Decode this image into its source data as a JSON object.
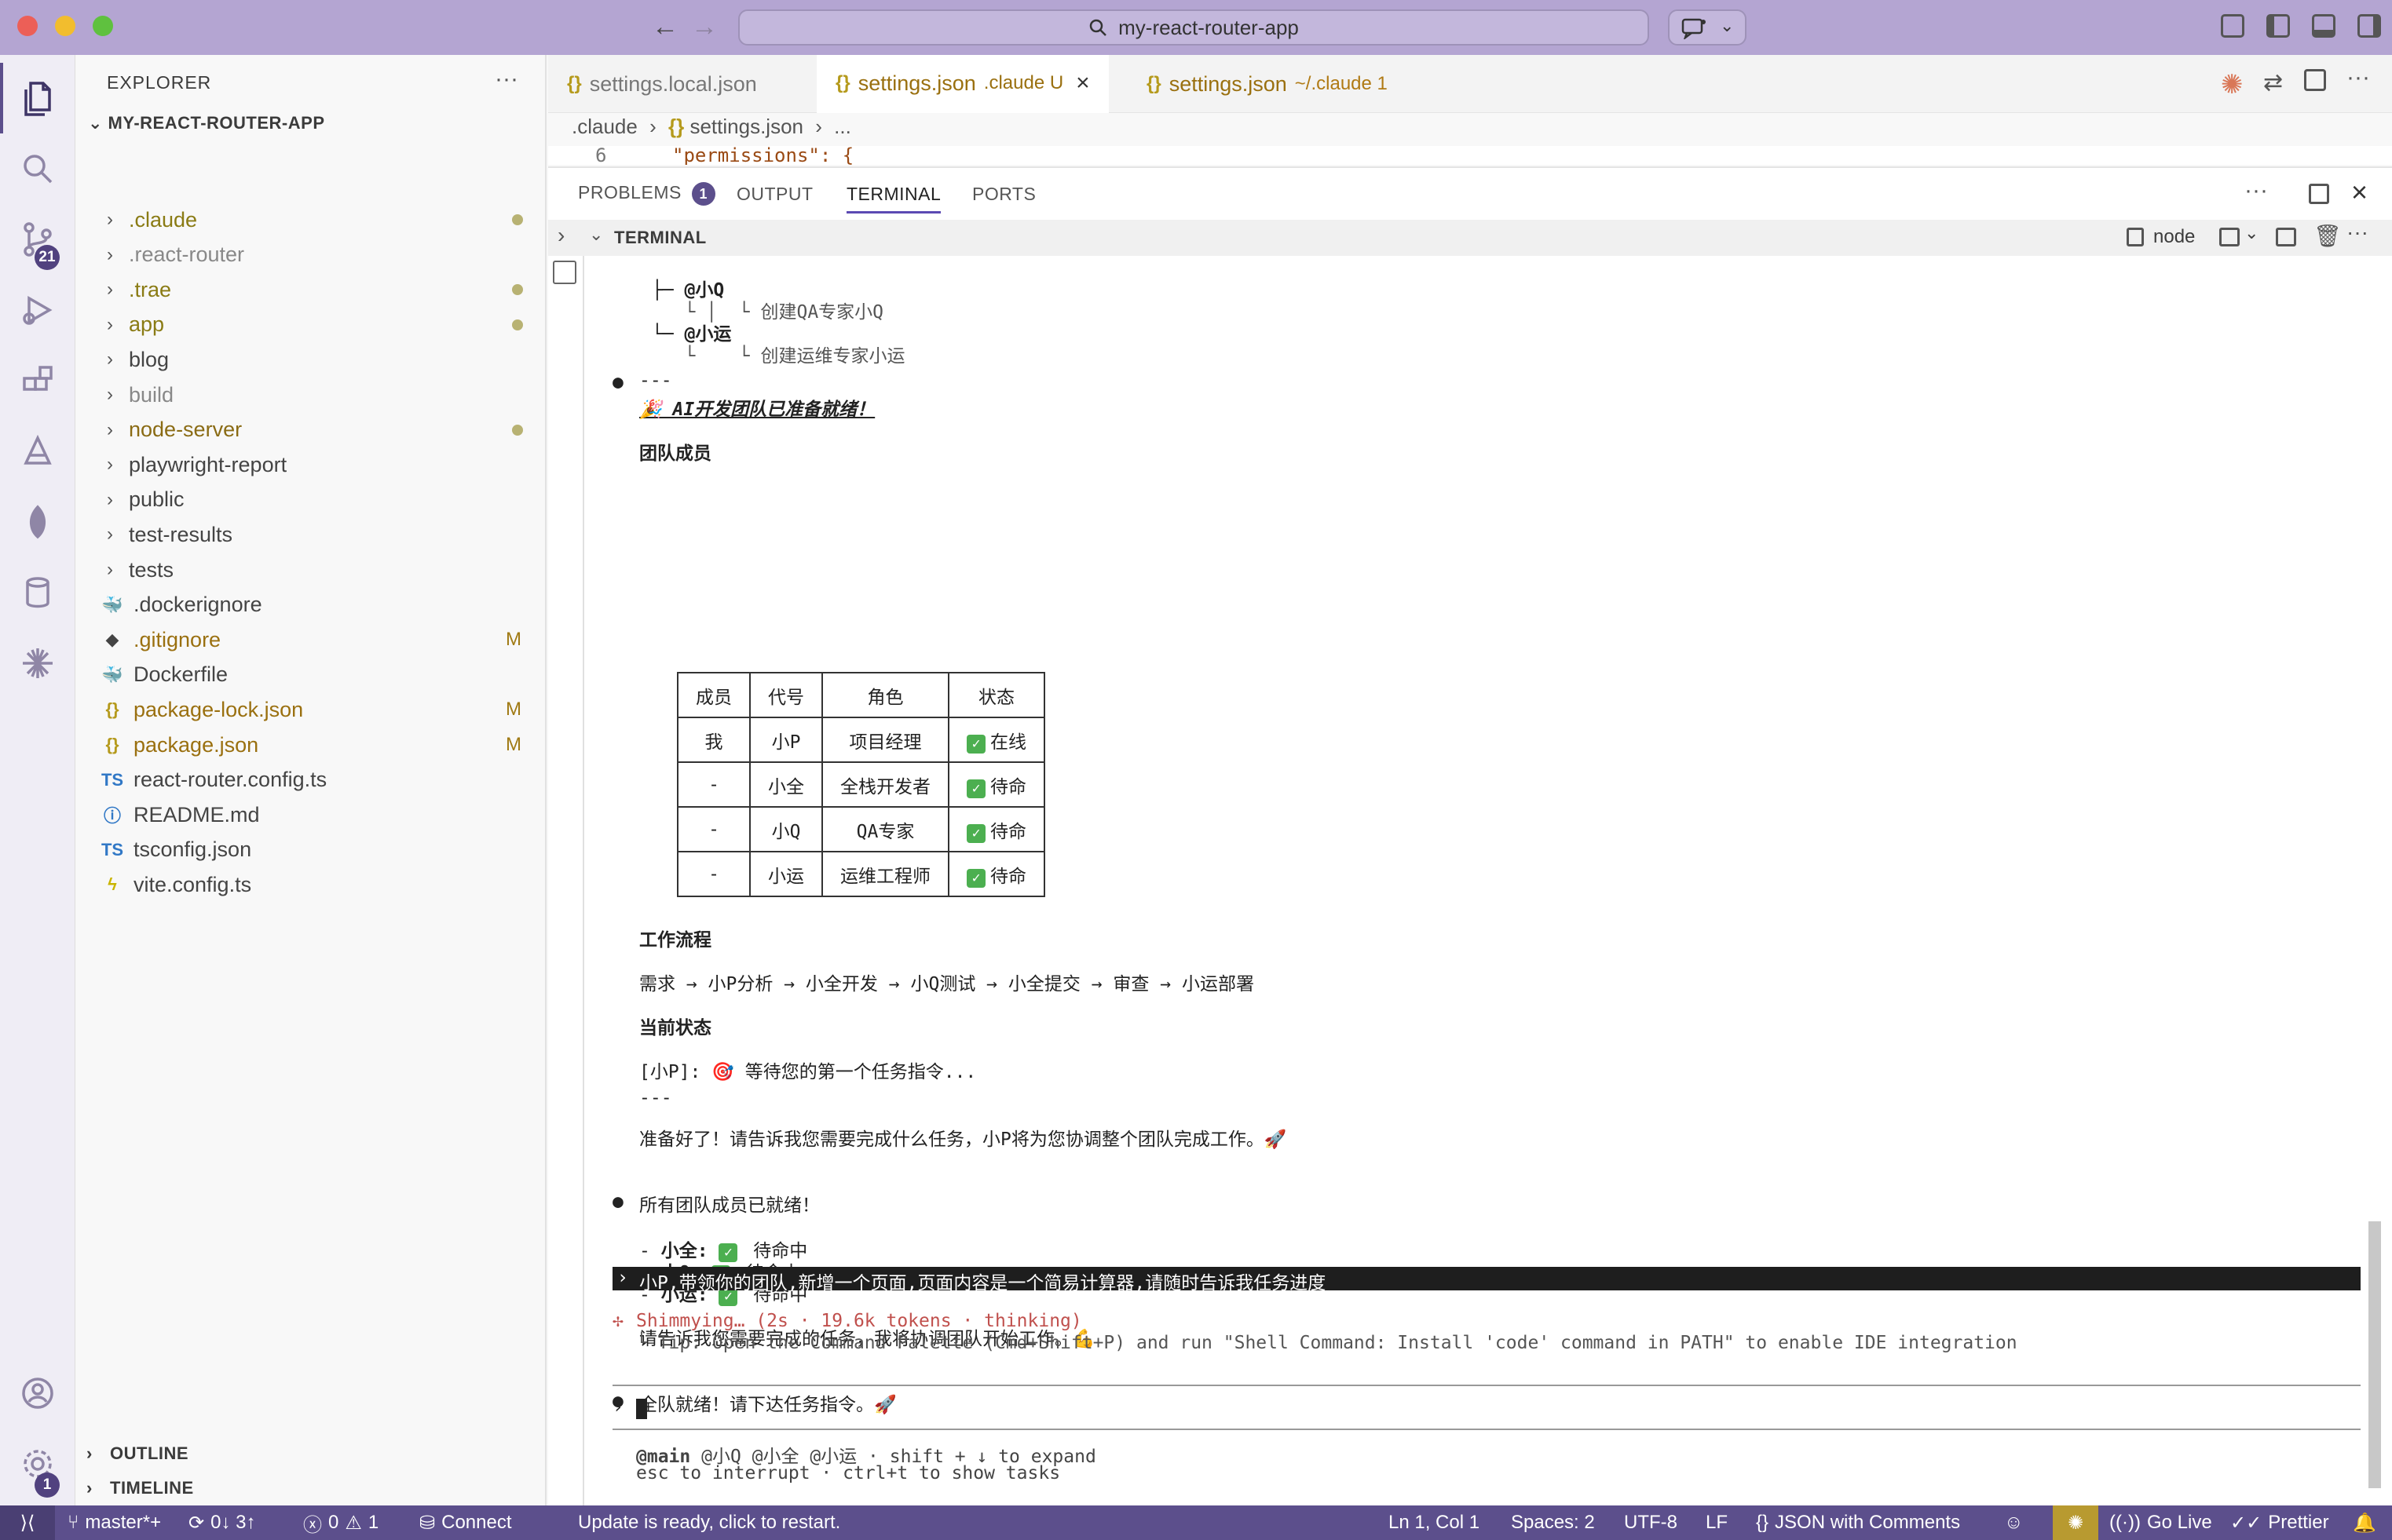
{
  "window": {
    "search": "my-react-router-app"
  },
  "activity": {
    "scm_badge": "21",
    "settings_badge": "1"
  },
  "explorer": {
    "title": "EXPLORER",
    "root": "MY-REACT-ROUTER-APP",
    "items": [
      {
        "name": ".claude",
        "folder": true,
        "color": "#8a7b14",
        "marker": "dot"
      },
      {
        "name": ".react-router",
        "folder": true,
        "color": "#888888",
        "marker": ""
      },
      {
        "name": ".trae",
        "folder": true,
        "color": "#8a7b14",
        "marker": "dot"
      },
      {
        "name": "app",
        "folder": true,
        "color": "#8a7b14",
        "marker": "dot"
      },
      {
        "name": "blog",
        "folder": true,
        "color": "#444444",
        "marker": ""
      },
      {
        "name": "build",
        "folder": true,
        "color": "#888888",
        "marker": ""
      },
      {
        "name": "node-server",
        "folder": true,
        "color": "#8a6b14",
        "marker": "dot"
      },
      {
        "name": "playwright-report",
        "folder": true,
        "color": "#444444",
        "marker": ""
      },
      {
        "name": "public",
        "folder": true,
        "color": "#444444",
        "marker": ""
      },
      {
        "name": "test-results",
        "folder": true,
        "color": "#444444",
        "marker": ""
      },
      {
        "name": "tests",
        "folder": true,
        "color": "#444444",
        "marker": ""
      },
      {
        "name": ".dockerignore",
        "folder": false,
        "icon": "🐳",
        "iconColor": "#555",
        "color": "#444444",
        "marker": ""
      },
      {
        "name": ".gitignore",
        "folder": false,
        "icon": "◆",
        "iconColor": "#444",
        "color": "#9a7010",
        "marker": "M"
      },
      {
        "name": "Dockerfile",
        "folder": false,
        "icon": "🐳",
        "iconColor": "#555",
        "color": "#444444",
        "marker": ""
      },
      {
        "name": "package-lock.json",
        "folder": false,
        "icon": "{}",
        "iconColor": "#b59a1c",
        "color": "#9a7010",
        "marker": "M"
      },
      {
        "name": "package.json",
        "folder": false,
        "icon": "{}",
        "iconColor": "#b59a1c",
        "color": "#9a7010",
        "marker": "M"
      },
      {
        "name": "react-router.config.ts",
        "folder": false,
        "icon": "TS",
        "iconColor": "#3178c6",
        "color": "#444444",
        "marker": ""
      },
      {
        "name": "README.md",
        "folder": false,
        "icon": "ⓘ",
        "iconColor": "#3178c6",
        "color": "#444444",
        "marker": ""
      },
      {
        "name": "tsconfig.json",
        "folder": false,
        "icon": "TS",
        "iconColor": "#3178c6",
        "color": "#444444",
        "marker": ""
      },
      {
        "name": "vite.config.ts",
        "folder": false,
        "icon": "ϟ",
        "iconColor": "#c9b400",
        "color": "#444444",
        "marker": ""
      }
    ],
    "outline": "OUTLINE",
    "timeline": "TIMELINE"
  },
  "tabs": [
    {
      "label": "settings.local.json",
      "desc": ""
    },
    {
      "label": "settings.json",
      "desc": ".claude U"
    },
    {
      "label": "settings.json",
      "desc": "~/.claude 1"
    }
  ],
  "breadcrumb": {
    "folder": ".claude",
    "file": "settings.json",
    "more": "..."
  },
  "editor": {
    "line_no": "6",
    "code": "\"permissions\": {"
  },
  "panel": {
    "tabs": [
      "PROBLEMS",
      "OUTPUT",
      "TERMINAL",
      "PORTS"
    ],
    "problems_badge": "1",
    "terminal_title": "TERMINAL",
    "shell": "node"
  },
  "terminal": {
    "tree": [
      "├─ @小Q",
      "│  └ 创建QA专家小Q",
      "└─ @小运",
      "   └ 创建运维专家小运"
    ],
    "rule1": "---",
    "ready_title": "🎉 AI开发团队已准备就绪！",
    "members_title": "团队成员",
    "table_head": [
      "成员",
      "代号",
      "角色",
      "状态"
    ],
    "table_rows": [
      [
        "我",
        "小P",
        "项目经理",
        "在线"
      ],
      [
        "-",
        "小全",
        "全栈开发者",
        "待命"
      ],
      [
        "-",
        "小Q",
        "QA专家",
        "待命"
      ],
      [
        "-",
        "小运",
        "运维工程师",
        "待命"
      ]
    ],
    "workflow_title": "工作流程",
    "workflow": "需求 → 小P分析 → 小全开发 → 小Q测试 → 小全提交 → 审查 → 小运部署",
    "status_title": "当前状态",
    "status_line": "[小P]: 🎯 等待您的第一个任务指令...",
    "rule2": "---",
    "ready_msg": "准备好了！请告诉我您需要完成什么任务，小P将为您协调整个团队完成工作。🚀",
    "all_ready": "所有团队成员已就绪！",
    "member_lines": [
      {
        "name": "小全:",
        "state": "待命中"
      },
      {
        "name": "小Q:",
        "state": "待命中"
      },
      {
        "name": "小运:",
        "state": "待命中"
      }
    ],
    "tell_msg": "请告诉我您需要完成的任务，我将协调团队开始工作。💪",
    "team_ready": "全队就绪！请下达任务指令。🚀",
    "user_prompt": "小P,带领你的团队,新增一个页面,页面内容是一个简易计算器,请随时告诉我任务进度",
    "thinking": "Shimmying… (2s · 19.6k tokens · thinking)",
    "tip": "└ Tip: Open the Command Palette (Cmd+Shift+P) and run \"Shell Command: Install 'code' command in PATH\" to enable IDE integration",
    "footer1_bold": "@main",
    "footer1_rest": " @小Q @小全 @小运 · shift + ↓ to expand",
    "footer2": "esc to interrupt · ctrl+t to show tasks"
  },
  "statusbar": {
    "branch": "master*+",
    "sync": "0↓ 3↑",
    "errors": "0",
    "warnings": "1",
    "connect": "Connect",
    "update": "Update is ready, click to restart.",
    "position": "Ln 1, Col 1",
    "spaces": "Spaces: 2",
    "encoding": "UTF-8",
    "eol": "LF",
    "language": "JSON with Comments",
    "golive": "Go Live",
    "prettier": "Prettier"
  },
  "colors": {
    "accent": "#5c4f8c",
    "titlebar": "#b4a5d2"
  }
}
